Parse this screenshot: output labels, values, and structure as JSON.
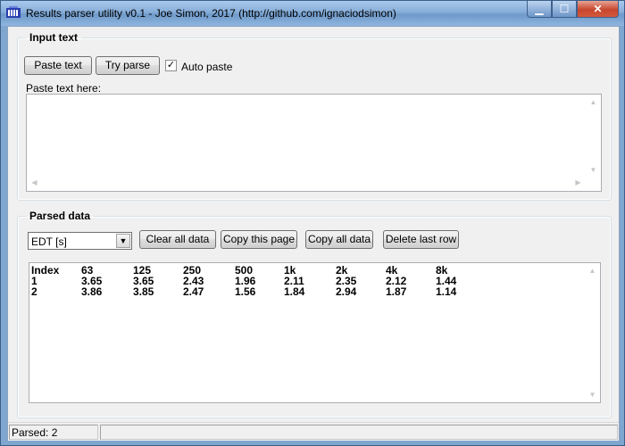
{
  "window": {
    "title": "Results parser utility v0.1 - Joe Simon, 2017 (http://github.com/ignaciodsimon)",
    "min_glyph": "▁",
    "max_glyph": "☐",
    "close_glyph": "✕"
  },
  "input_section": {
    "legend": "Input text",
    "paste_button": "Paste text",
    "try_parse_button": "Try parse",
    "auto_paste_label": "Auto paste",
    "auto_paste_checked": true,
    "check_glyph": "✓",
    "textarea_label": "Paste text here:",
    "textarea_value": ""
  },
  "parsed_section": {
    "legend": "Parsed data",
    "parameter_select": "EDT [s]",
    "buttons": {
      "clear_all": "Clear all data",
      "copy_page": "Copy this page",
      "copy_all": "Copy all data",
      "delete_last": "Delete last row"
    },
    "table": {
      "headers": [
        "Index",
        "63",
        "125",
        "250",
        "500",
        "1k",
        "2k",
        "4k",
        "8k"
      ],
      "rows": [
        [
          "1",
          "3.65",
          "3.65",
          "2.43",
          "1.96",
          "2.11",
          "2.35",
          "2.12",
          "1.44"
        ],
        [
          "2",
          "3.86",
          "3.85",
          "2.47",
          "1.56",
          "1.84",
          "2.94",
          "1.87",
          "1.14"
        ]
      ]
    }
  },
  "status": {
    "text": "Parsed: 2"
  },
  "scroll_glyphs": {
    "up": "▲",
    "down": "▼",
    "left": "◀",
    "right": "▶",
    "dropdown": "▼"
  },
  "colors": {
    "title_bar": "#86add8",
    "close_button": "#c7472e",
    "client_background": "#f0f0f0"
  }
}
